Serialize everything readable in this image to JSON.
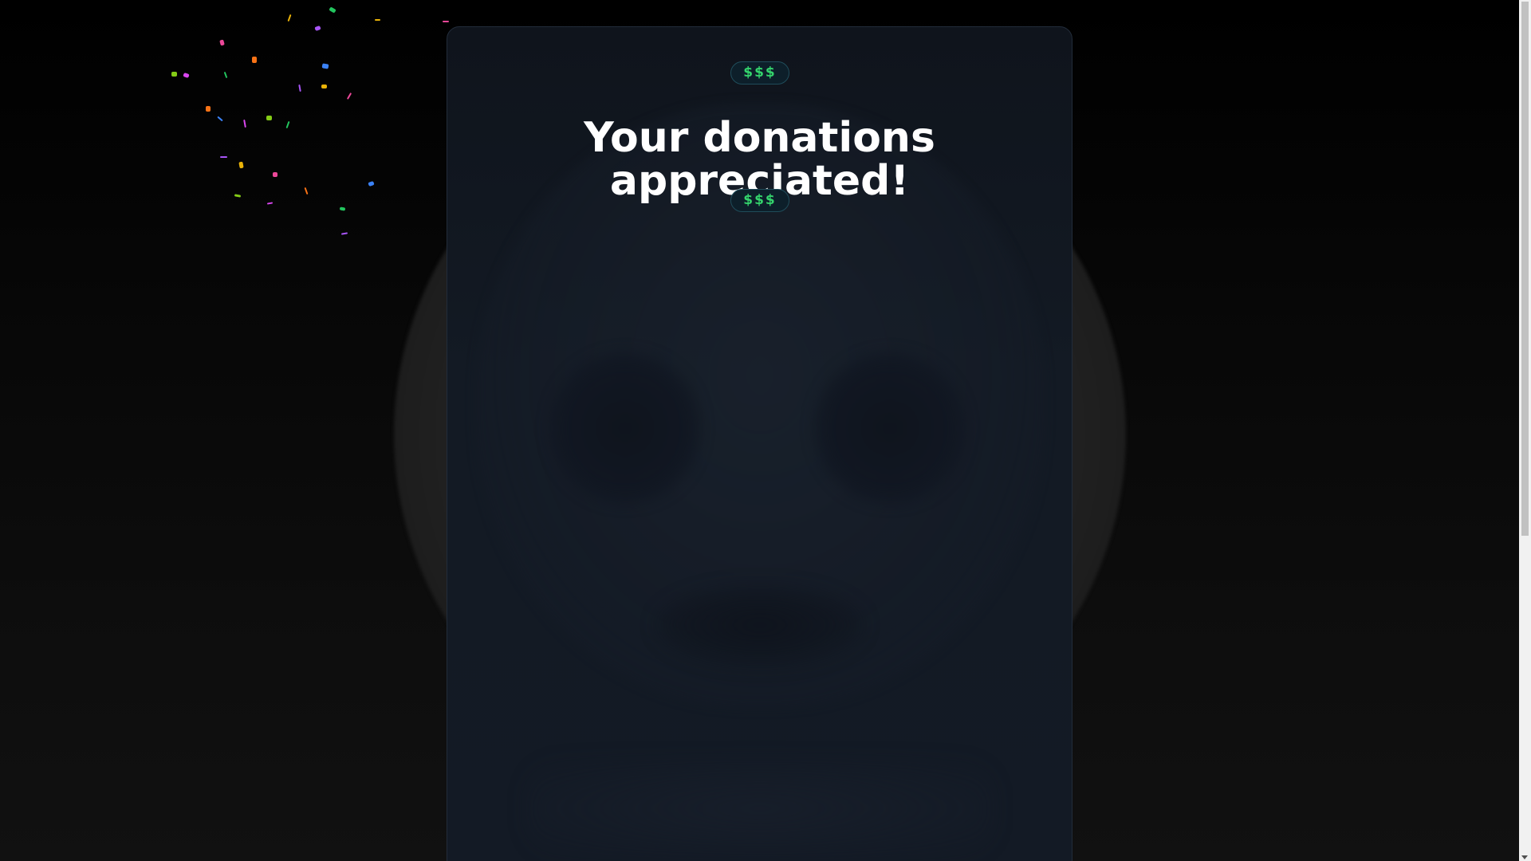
{
  "page": {
    "badge_top": "$$$",
    "title": "Your donations appreciated!",
    "badge_bottom": "$$$"
  },
  "colors": {
    "accent_green": "#34d36c",
    "card_background": "#131a24",
    "page_background": "#000000"
  },
  "confetti_colors": [
    "#22c55e",
    "#a855f7",
    "#eab308",
    "#ec4899",
    "#f97316",
    "#3b82f6",
    "#84cc16",
    "#d946ef"
  ],
  "icons": {
    "badge_icon": "dollar-sign-icon"
  }
}
